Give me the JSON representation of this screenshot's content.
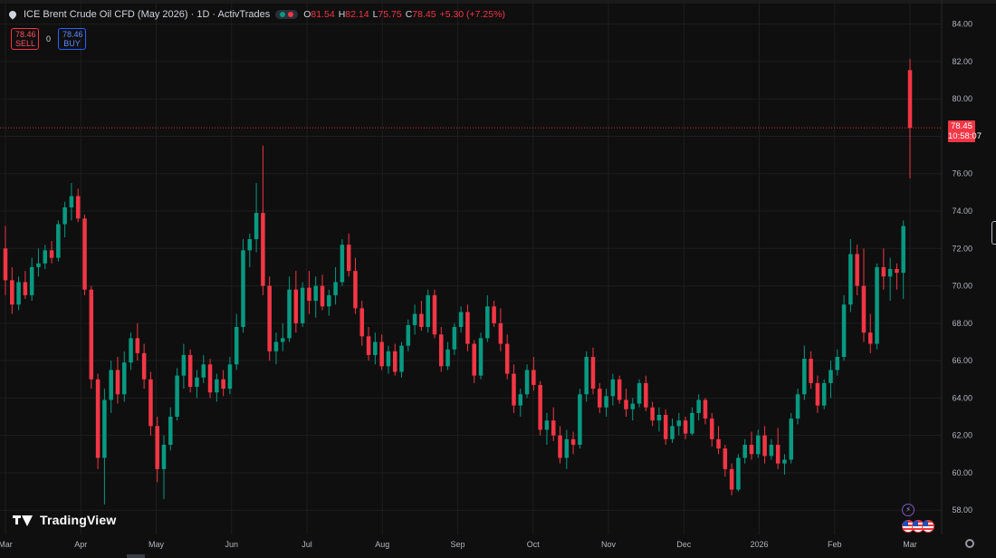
{
  "header": {
    "symbol": "ICE Brent Crude Oil CFD (May 2026) · 1D · ActivTrades",
    "ohlc": [
      {
        "k": "O",
        "v": "81.54"
      },
      {
        "k": "H",
        "v": "82.14"
      },
      {
        "k": "L",
        "v": "75.75"
      },
      {
        "k": "C",
        "v": "78.45"
      },
      {
        "k": "",
        "v": "+5.30 (+7.25%)"
      }
    ]
  },
  "trade": {
    "sell_price": "78.46",
    "sell_label": "SELL",
    "spread": "0",
    "buy_price": "78.46",
    "buy_label": "BUY"
  },
  "last_price": {
    "value": "78.45",
    "countdown": "10:58:07"
  },
  "branding": {
    "logo_text": "TradingView"
  },
  "colors": {
    "up": "#089981",
    "down": "#f23645",
    "background": "#0f0f0f",
    "grid": "#1e1e1e"
  },
  "icons": {
    "settings": "gear-icon",
    "events": "lightning-icon",
    "flags": "us-flag-icon"
  },
  "chart_data": {
    "type": "candlestick",
    "y_ticks": [
      "84.00",
      "82.00",
      "80.00",
      "78.00",
      "76.00",
      "74.00",
      "72.00",
      "70.00",
      "68.00",
      "66.00",
      "64.00",
      "62.00",
      "60.00",
      "58.00"
    ],
    "ylim": [
      56.8,
      85.0
    ],
    "x_labels": [
      "Mar",
      "Apr",
      "May",
      "Jun",
      "Jul",
      "Aug",
      "Sep",
      "Oct",
      "Nov",
      "Dec",
      "2026",
      "Feb",
      "Mar"
    ],
    "grid": true,
    "price_line": 78.45,
    "candles": [
      [
        72.0,
        73.2,
        69.5,
        70.3
      ],
      [
        70.3,
        71.0,
        68.5,
        69.0
      ],
      [
        69.0,
        70.5,
        68.7,
        70.2
      ],
      [
        70.2,
        70.8,
        69.3,
        69.5
      ],
      [
        69.5,
        71.5,
        69.2,
        71.0
      ],
      [
        71.0,
        72.0,
        70.5,
        71.2
      ],
      [
        71.2,
        72.2,
        70.9,
        71.9
      ],
      [
        71.9,
        72.4,
        71.2,
        71.5
      ],
      [
        71.5,
        73.5,
        71.3,
        73.3
      ],
      [
        73.3,
        74.5,
        72.6,
        74.2
      ],
      [
        74.2,
        75.5,
        73.5,
        74.8
      ],
      [
        74.8,
        75.2,
        73.4,
        73.6
      ],
      [
        73.6,
        73.8,
        69.5,
        69.8
      ],
      [
        69.8,
        70.0,
        64.5,
        65.0
      ],
      [
        65.0,
        65.3,
        60.2,
        60.8
      ],
      [
        60.8,
        64.5,
        58.3,
        63.9
      ],
      [
        63.9,
        66.0,
        63.2,
        65.5
      ],
      [
        65.5,
        66.2,
        63.7,
        64.2
      ],
      [
        64.2,
        66.5,
        63.8,
        65.9
      ],
      [
        65.9,
        67.5,
        65.5,
        67.2
      ],
      [
        67.2,
        68.0,
        66.0,
        66.4
      ],
      [
        66.4,
        66.9,
        64.5,
        65.0
      ],
      [
        65.0,
        65.4,
        62.0,
        62.5
      ],
      [
        62.5,
        63.0,
        59.5,
        60.2
      ],
      [
        60.2,
        62.0,
        58.6,
        61.5
      ],
      [
        61.5,
        63.5,
        61.2,
        63.0
      ],
      [
        63.0,
        65.6,
        62.8,
        65.2
      ],
      [
        65.2,
        66.9,
        64.5,
        66.3
      ],
      [
        66.3,
        66.6,
        64.3,
        64.6
      ],
      [
        64.6,
        65.5,
        64.0,
        65.1
      ],
      [
        65.1,
        66.3,
        64.8,
        65.8
      ],
      [
        65.8,
        66.1,
        64.0,
        64.3
      ],
      [
        64.3,
        65.3,
        63.8,
        65.0
      ],
      [
        65.0,
        65.5,
        64.1,
        64.5
      ],
      [
        64.5,
        66.2,
        64.2,
        65.8
      ],
      [
        65.8,
        68.5,
        65.5,
        67.8
      ],
      [
        67.8,
        72.5,
        67.5,
        71.9
      ],
      [
        71.9,
        72.8,
        71.0,
        72.5
      ],
      [
        72.5,
        75.5,
        71.8,
        73.9
      ],
      [
        73.9,
        77.5,
        69.5,
        70.0
      ],
      [
        70.0,
        70.5,
        66.0,
        66.5
      ],
      [
        66.5,
        67.5,
        65.8,
        67.0
      ],
      [
        67.0,
        68.0,
        66.5,
        67.2
      ],
      [
        67.2,
        70.5,
        67.0,
        69.8
      ],
      [
        69.8,
        70.8,
        67.5,
        68.0
      ],
      [
        68.0,
        70.2,
        67.8,
        69.9
      ],
      [
        69.9,
        70.8,
        68.5,
        69.2
      ],
      [
        69.2,
        70.5,
        68.3,
        70.0
      ],
      [
        70.0,
        70.6,
        68.7,
        68.9
      ],
      [
        68.9,
        69.8,
        68.4,
        69.5
      ],
      [
        69.5,
        71.0,
        69.0,
        70.2
      ],
      [
        70.2,
        72.5,
        70.0,
        72.2
      ],
      [
        72.2,
        72.8,
        70.5,
        70.8
      ],
      [
        70.8,
        71.5,
        68.5,
        68.8
      ],
      [
        68.8,
        69.2,
        66.8,
        67.3
      ],
      [
        67.3,
        67.8,
        66.0,
        66.3
      ],
      [
        66.3,
        67.5,
        65.8,
        67.0
      ],
      [
        67.0,
        67.4,
        65.5,
        65.7
      ],
      [
        65.7,
        66.8,
        65.3,
        66.5
      ],
      [
        66.5,
        66.9,
        65.2,
        65.4
      ],
      [
        65.4,
        67.0,
        65.1,
        66.8
      ],
      [
        66.8,
        68.2,
        66.5,
        67.9
      ],
      [
        67.9,
        69.0,
        67.4,
        68.5
      ],
      [
        68.5,
        69.2,
        67.6,
        67.8
      ],
      [
        67.8,
        69.8,
        67.5,
        69.5
      ],
      [
        69.5,
        69.8,
        67.2,
        67.4
      ],
      [
        67.4,
        67.8,
        65.4,
        65.7
      ],
      [
        65.7,
        67.0,
        65.5,
        66.6
      ],
      [
        66.6,
        68.0,
        66.3,
        67.8
      ],
      [
        67.8,
        68.9,
        67.5,
        68.6
      ],
      [
        68.6,
        69.0,
        66.5,
        66.9
      ],
      [
        66.9,
        67.1,
        64.8,
        65.2
      ],
      [
        65.2,
        67.5,
        65.0,
        67.2
      ],
      [
        67.2,
        69.5,
        67.0,
        68.9
      ],
      [
        68.9,
        69.2,
        67.8,
        68.0
      ],
      [
        68.0,
        68.8,
        66.5,
        66.9
      ],
      [
        66.9,
        67.4,
        65.0,
        65.3
      ],
      [
        65.3,
        65.8,
        63.2,
        63.6
      ],
      [
        63.6,
        64.5,
        63.0,
        64.2
      ],
      [
        64.2,
        65.8,
        64.0,
        65.5
      ],
      [
        65.5,
        66.2,
        64.4,
        64.7
      ],
      [
        64.7,
        64.9,
        62.0,
        62.3
      ],
      [
        62.3,
        63.2,
        61.5,
        62.8
      ],
      [
        62.8,
        63.5,
        61.7,
        62.0
      ],
      [
        62.0,
        62.5,
        60.5,
        60.8
      ],
      [
        60.8,
        62.3,
        60.2,
        61.8
      ],
      [
        61.8,
        62.2,
        61.0,
        61.5
      ],
      [
        61.5,
        64.5,
        61.3,
        64.2
      ],
      [
        64.2,
        66.5,
        63.8,
        66.2
      ],
      [
        66.2,
        66.7,
        64.2,
        64.5
      ],
      [
        64.5,
        64.8,
        63.2,
        63.5
      ],
      [
        63.5,
        64.5,
        63.0,
        64.1
      ],
      [
        64.1,
        65.3,
        63.6,
        65.0
      ],
      [
        65.0,
        65.2,
        63.7,
        63.9
      ],
      [
        63.9,
        64.5,
        63.0,
        63.4
      ],
      [
        63.4,
        64.0,
        62.8,
        63.7
      ],
      [
        63.7,
        65.0,
        63.5,
        64.8
      ],
      [
        64.8,
        65.2,
        63.3,
        63.5
      ],
      [
        63.5,
        63.8,
        62.5,
        62.8
      ],
      [
        62.8,
        63.5,
        62.2,
        63.1
      ],
      [
        63.1,
        63.4,
        61.5,
        61.8
      ],
      [
        61.8,
        62.9,
        61.6,
        62.5
      ],
      [
        62.5,
        63.2,
        62.0,
        62.8
      ],
      [
        62.8,
        63.0,
        61.8,
        62.1
      ],
      [
        62.1,
        63.5,
        62.0,
        63.2
      ],
      [
        63.2,
        64.2,
        62.8,
        63.9
      ],
      [
        63.9,
        64.0,
        62.6,
        62.9
      ],
      [
        62.9,
        63.2,
        61.4,
        61.8
      ],
      [
        61.8,
        62.5,
        61.0,
        61.3
      ],
      [
        61.3,
        61.5,
        59.8,
        60.2
      ],
      [
        60.2,
        60.5,
        58.8,
        59.1
      ],
      [
        59.1,
        61.0,
        59.0,
        60.8
      ],
      [
        60.8,
        61.8,
        60.5,
        61.5
      ],
      [
        61.5,
        62.2,
        60.7,
        61.0
      ],
      [
        61.0,
        62.3,
        60.8,
        62.0
      ],
      [
        62.0,
        62.5,
        60.5,
        60.9
      ],
      [
        60.9,
        61.8,
        60.7,
        61.5
      ],
      [
        61.5,
        62.4,
        60.2,
        60.5
      ],
      [
        60.5,
        61.0,
        59.9,
        60.7
      ],
      [
        60.7,
        63.2,
        60.5,
        62.9
      ],
      [
        62.9,
        64.5,
        62.6,
        64.2
      ],
      [
        64.2,
        66.8,
        63.9,
        66.1
      ],
      [
        66.1,
        66.5,
        64.5,
        64.8
      ],
      [
        64.8,
        65.2,
        63.2,
        63.6
      ],
      [
        63.6,
        65.0,
        63.4,
        64.8
      ],
      [
        64.8,
        66.0,
        64.0,
        65.5
      ],
      [
        65.5,
        66.6,
        65.2,
        66.2
      ],
      [
        66.2,
        69.5,
        66.0,
        69.0
      ],
      [
        69.0,
        72.5,
        68.6,
        71.7
      ],
      [
        71.7,
        72.2,
        69.5,
        70.0
      ],
      [
        70.0,
        72.0,
        67.0,
        67.5
      ],
      [
        67.5,
        68.5,
        66.4,
        66.9
      ],
      [
        66.9,
        71.2,
        66.6,
        71.0
      ],
      [
        71.0,
        72.0,
        69.8,
        70.5
      ],
      [
        70.5,
        71.5,
        69.2,
        70.9
      ],
      [
        70.9,
        71.2,
        69.8,
        70.7
      ],
      [
        70.7,
        73.5,
        69.3,
        73.2
      ],
      [
        81.54,
        82.14,
        75.75,
        78.45
      ]
    ]
  }
}
